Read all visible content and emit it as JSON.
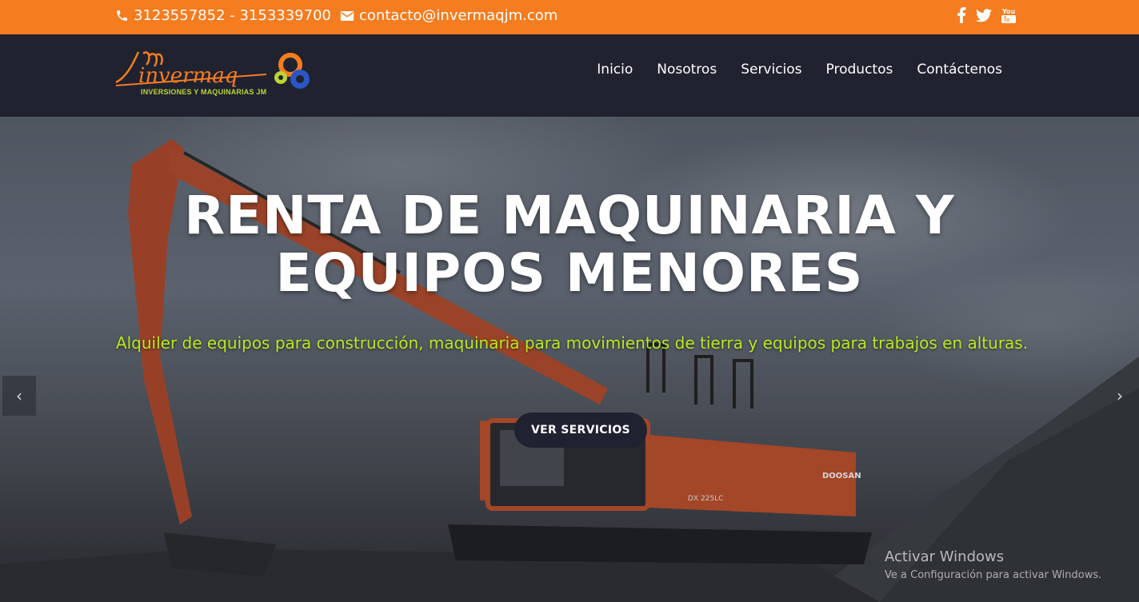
{
  "topbar": {
    "phone": "3123557852 - 3153339700",
    "email": "contacto@invermaqjm.com",
    "phone_icon": "phone-icon",
    "email_icon": "envelope-icon",
    "social_icons": [
      "facebook-icon",
      "twitter-icon",
      "youtube-icon"
    ],
    "youtube_text": "You"
  },
  "logo": {
    "script": "jm",
    "name": "invermaq",
    "tagline": "INVERSIONES Y MAQUINARIAS JM"
  },
  "nav": {
    "items": [
      "Inicio",
      "Nosotros",
      "Servicios",
      "Productos",
      "Contáctenos"
    ]
  },
  "hero": {
    "title_line1": "RENTA DE MAQUINARIA Y",
    "title_line2": "EQUIPOS MENORES",
    "subtitle": "Alquiler de equipos para construcción, maquinaria para movimientos de tierra y equipos para trabajos en alturas.",
    "cta": "VER SERVICIOS",
    "prev_arrow": "‹",
    "next_arrow": "›",
    "brand_on_machine": "DOOSAN",
    "model_on_machine": "DX 225LC"
  },
  "watermark": {
    "title": "Activar Windows",
    "subtitle": "Ve a Configuración para activar Windows."
  },
  "colors": {
    "accent": "#f57c1f",
    "header_bg": "#202230",
    "subtitle": "#b9ea1c",
    "logo_tagline": "#b9d633"
  }
}
